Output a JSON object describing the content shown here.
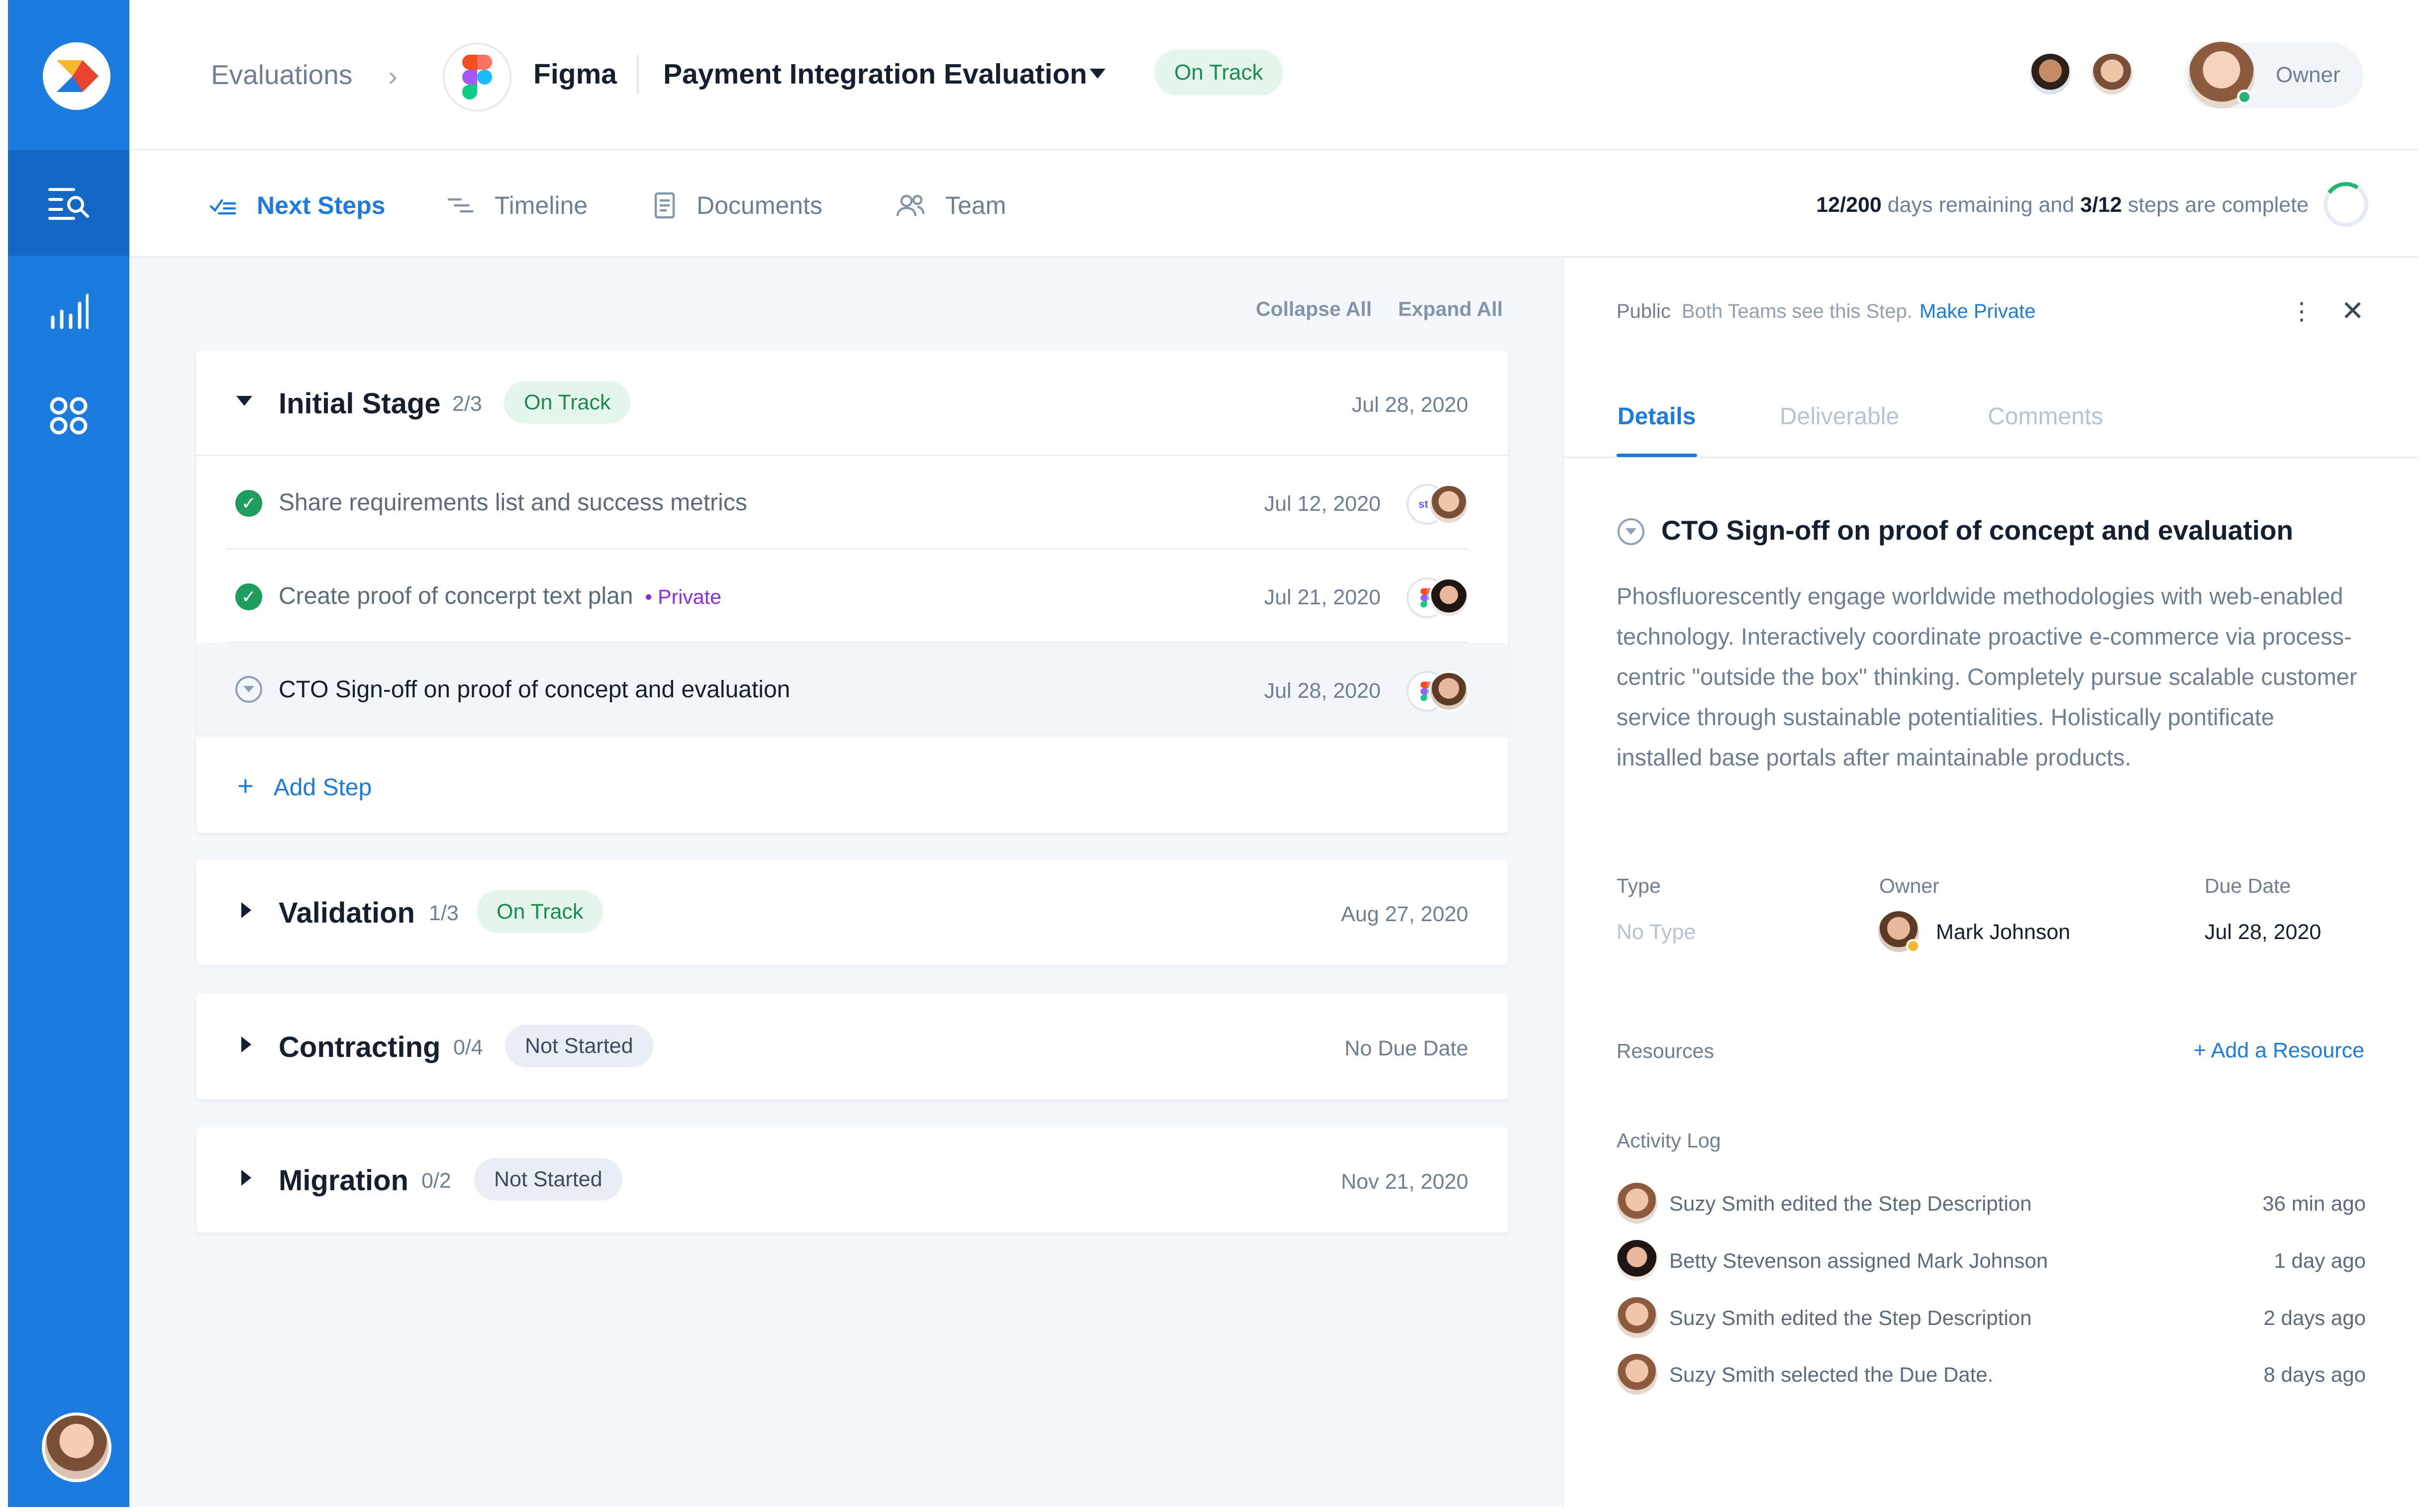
{
  "colors": {
    "brand": "#1c7bde",
    "success": "#1f9d5c",
    "private": "#8a2be2"
  },
  "header": {
    "breadcrumb": "Evaluations",
    "company": "Figma",
    "evaluation_title": "Payment Integration Evaluation",
    "status": "On Track",
    "owner_label": "Owner"
  },
  "subnav": {
    "tabs": [
      {
        "label": "Next Steps",
        "icon": "checklist-icon",
        "active": true
      },
      {
        "label": "Timeline",
        "icon": "timeline-icon"
      },
      {
        "label": "Documents",
        "icon": "document-icon"
      },
      {
        "label": "Team",
        "icon": "team-icon"
      }
    ],
    "days": "12/200",
    "days_text": "days remaining and",
    "steps": "3/12",
    "steps_text": "steps are complete"
  },
  "list": {
    "collapse_all": "Collapse All",
    "expand_all": "Expand All",
    "add_step": "Add Step",
    "stages": [
      {
        "name": "Initial Stage",
        "count": "2/3",
        "status": "On Track",
        "date": "Jul 28, 2020",
        "steps": [
          {
            "text": "Share requirements list and success metrics",
            "date": "Jul 12, 2020",
            "done": true,
            "logo": "stri"
          },
          {
            "text": "Create proof of concerpt text plan",
            "private": "• Private",
            "date": "Jul 21, 2020",
            "done": true
          },
          {
            "text": "CTO Sign-off on proof of concept and evaluation",
            "date": "Jul 28, 2020",
            "done": false
          }
        ]
      },
      {
        "name": "Validation",
        "count": "1/3",
        "status": "On Track",
        "date": "Aug 27, 2020"
      },
      {
        "name": "Contracting",
        "count": "0/4",
        "status": "Not Started",
        "date": "No Due Date"
      },
      {
        "name": "Migration",
        "count": "0/2",
        "status": "Not Started",
        "date": "Nov 21, 2020"
      }
    ]
  },
  "panel": {
    "visibility": "Public",
    "visibility_note": "Both Teams see this Step.",
    "make_private": "Make Private",
    "tabs": [
      "Details",
      "Deliverable",
      "Comments"
    ],
    "title": "CTO Sign-off on proof of concept and evaluation",
    "description": "Phosfluorescently engage worldwide methodologies with web-enabled technology. Interactively coordinate proactive e-commerce via process-centric \"outside the box\" thinking. Completely pursue scalable customer service through sustainable potentialities. Holistically pontificate installed base portals after maintainable products.",
    "type_label": "Type",
    "type_value": "No Type",
    "owner_label": "Owner",
    "owner_value": "Mark Johnson",
    "due_label": "Due Date",
    "due_value": "Jul 28, 2020",
    "resources_label": "Resources",
    "add_resource": "+ Add a Resource",
    "activity_label": "Activity Log",
    "activity": [
      {
        "text": "Suzy Smith edited the Step Description",
        "time": "36 min ago"
      },
      {
        "text": "Betty Stevenson assigned Mark Johnson",
        "time": "1 day ago"
      },
      {
        "text": "Suzy Smith edited the Step Description",
        "time": "2 days ago"
      },
      {
        "text": "Suzy Smith selected the Due Date.",
        "time": "8 days ago"
      }
    ]
  }
}
